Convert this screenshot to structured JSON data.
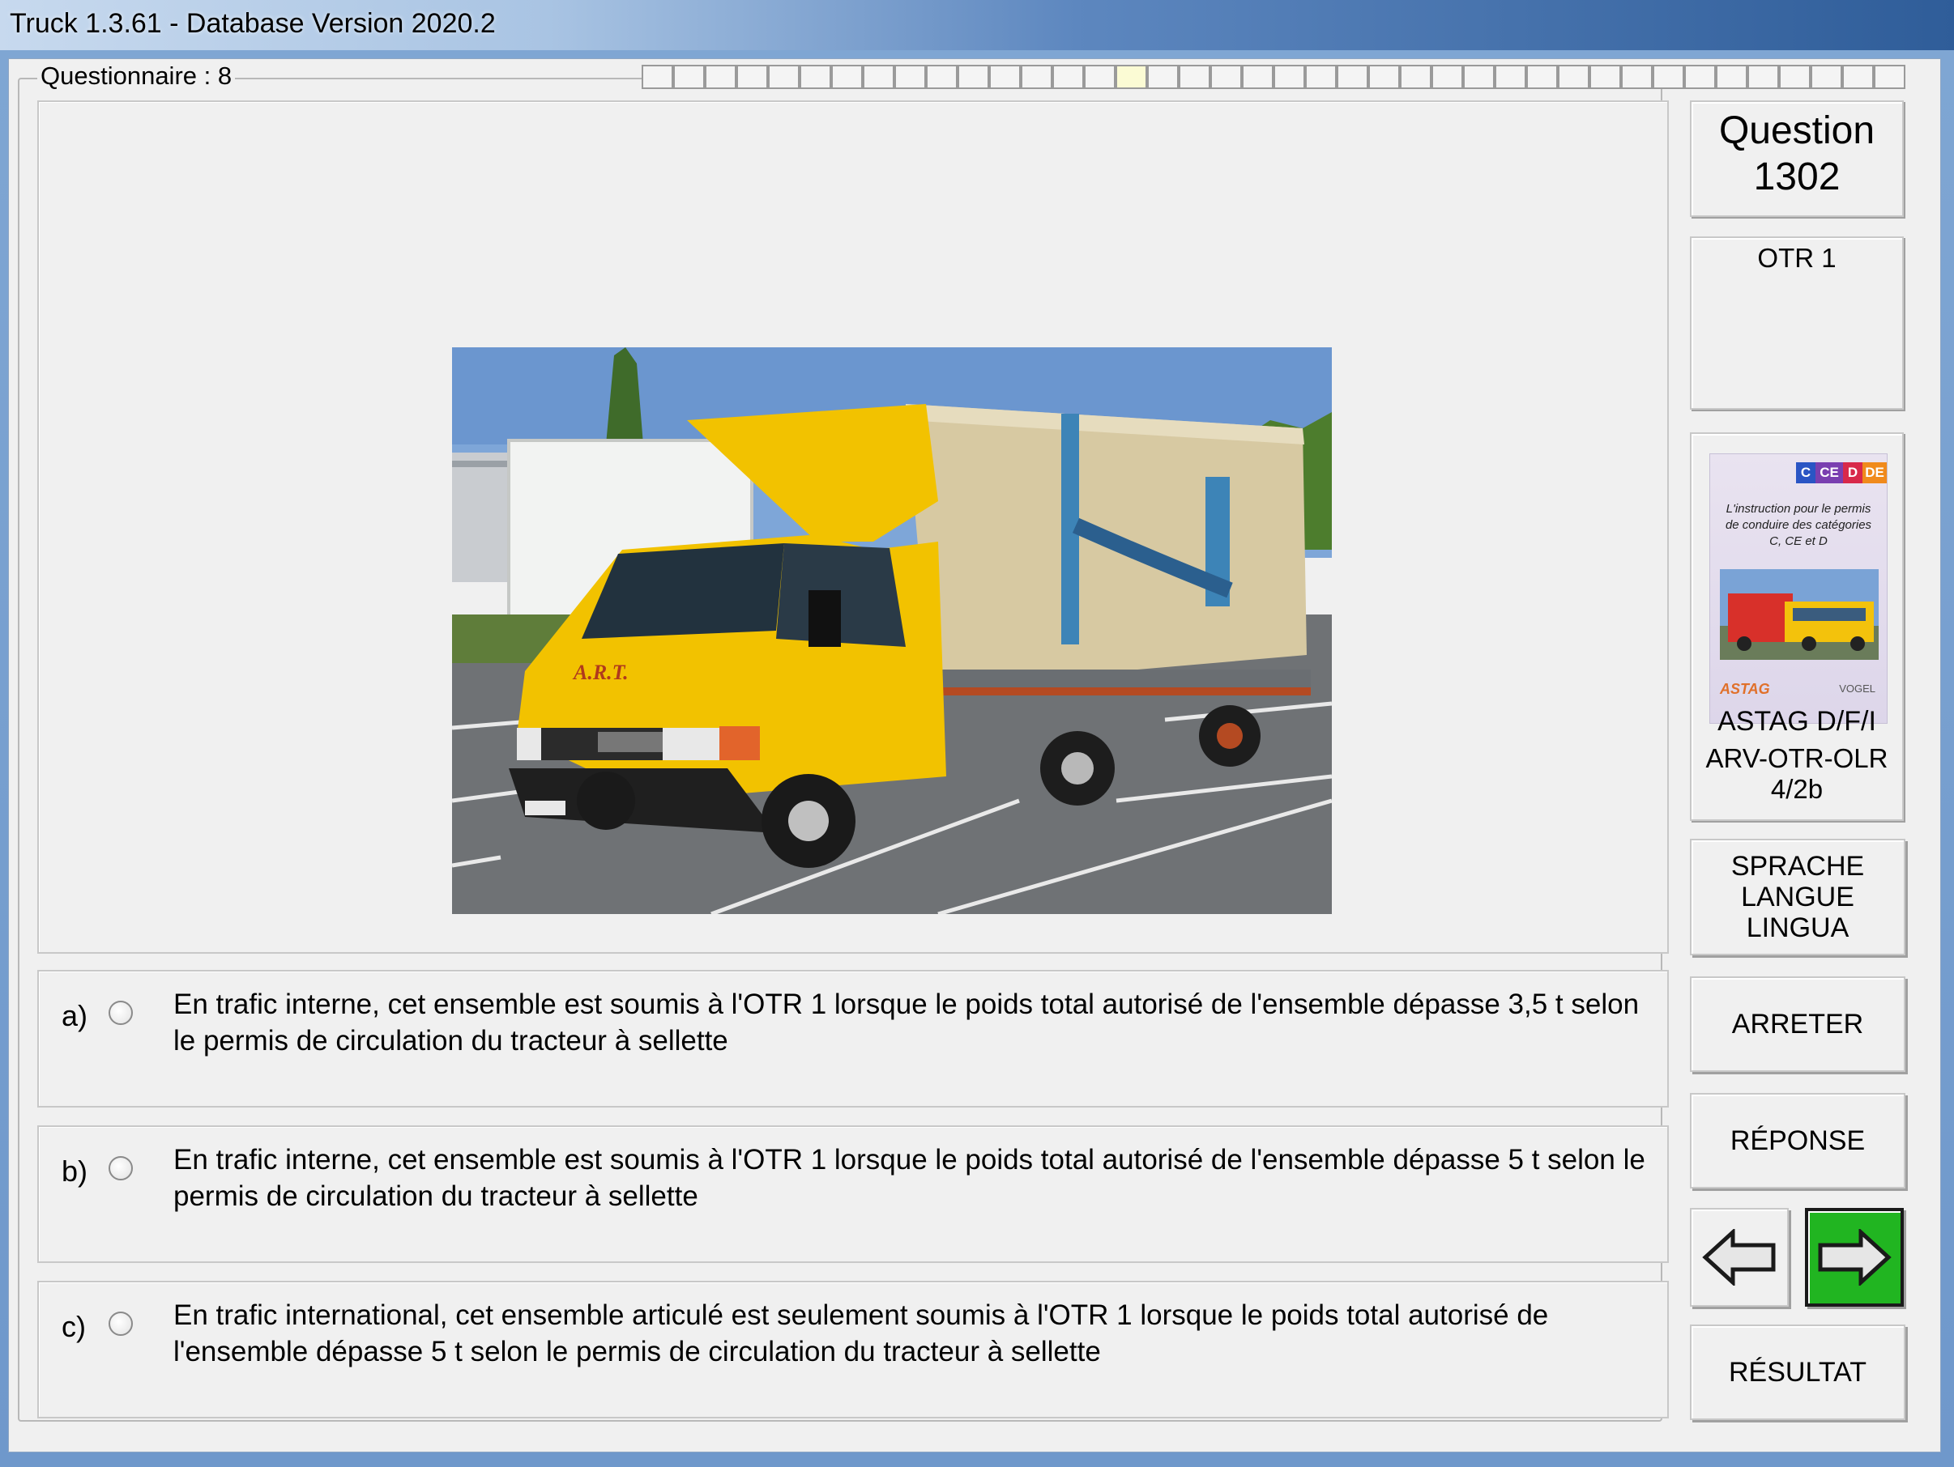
{
  "window": {
    "title": "Truck 1.3.61 - Database Version 2020.2"
  },
  "questionnaire": {
    "label": "Questionnaire : 8",
    "progress_total": 40,
    "progress_current": 16
  },
  "question": {
    "label": "Question",
    "number": "1302",
    "category": "OTR 1"
  },
  "photo": {
    "cab_lettering": "A.R.T."
  },
  "answers": [
    {
      "letter": "a)",
      "text": "En trafic interne, cet ensemble est soumis à l'OTR 1 lorsque le poids total autorisé de l'ensemble dépasse 3,5 t selon le permis de circulation du tracteur à sellette"
    },
    {
      "letter": "b)",
      "text": "En trafic interne, cet ensemble est soumis à l'OTR 1 lorsque le poids total autorisé de l'ensemble dépasse 5  t selon le permis de circulation du tracteur à sellette"
    },
    {
      "letter": "c)",
      "text": "En trafic international, cet ensemble articulé est seulement soumis à l'OTR 1 lorsque le poids total autorisé de l'ensemble dépasse 5  t selon le permis de circulation du tracteur à sellette"
    }
  ],
  "book": {
    "badges": [
      "C",
      "CE",
      "D",
      "DE"
    ],
    "cover_text": "L'instruction pour le permis de conduire des catégories C, CE et D",
    "publisher_left": "ASTAG",
    "publisher_right": "VOGEL",
    "line1": "ASTAG D/F/I",
    "line2": "ARV-OTR-OLR",
    "line3": "4/2b"
  },
  "buttons": {
    "language": [
      "SPRACHE",
      "LANGUE",
      "LINGUA"
    ],
    "stop": "ARRETER",
    "answer": "RÉPONSE",
    "result": "RÉSULTAT"
  },
  "colors": {
    "next_button": "#21b521",
    "truck_yellow": "#f2c200",
    "tarp": "#d7c9a2"
  }
}
